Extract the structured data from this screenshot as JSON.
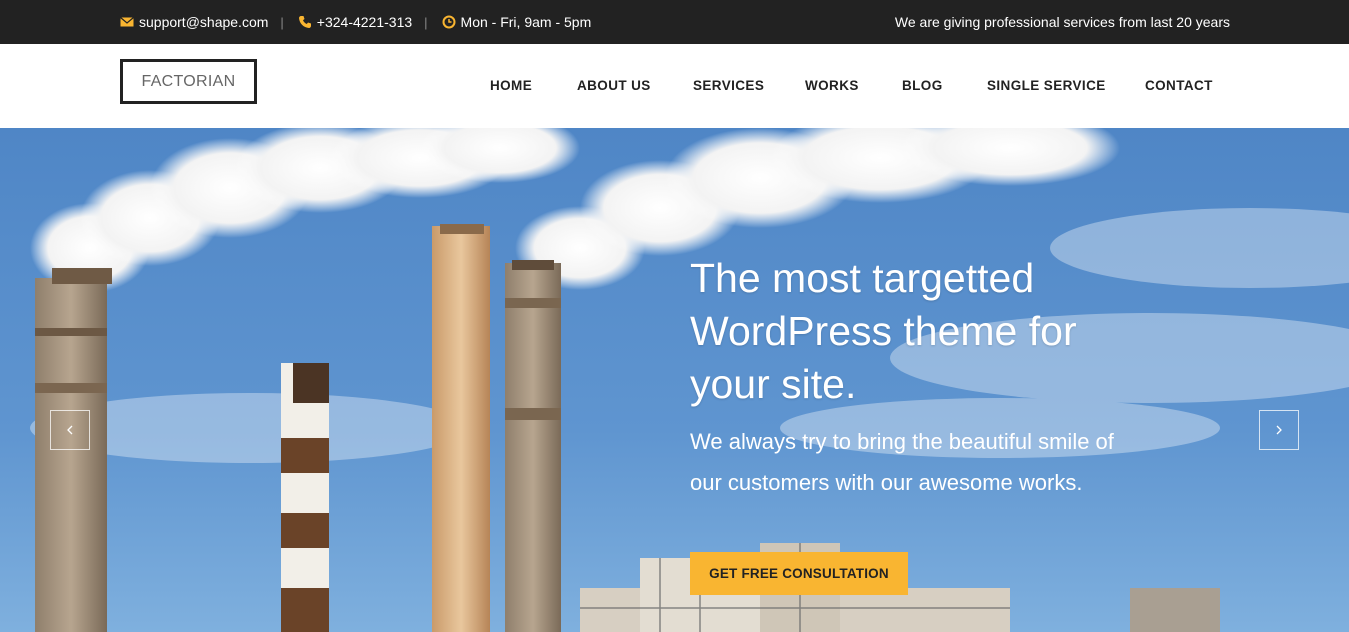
{
  "topbar": {
    "email": "support@shape.com",
    "phone": "+324-4221-313",
    "hours": "Mon - Fri, 9am - 5pm",
    "separator": "|",
    "tagline": "We are giving professional services from last 20 years",
    "icons": [
      "envelope-icon",
      "phone-icon",
      "clock-icon"
    ],
    "icon_color": "#f9b531"
  },
  "header": {
    "logo": "FACTORIAN",
    "nav": [
      "HOME",
      "ABOUT US",
      "SERVICES",
      "WORKS",
      "BLOG",
      "SINGLE SERVICE",
      "CONTACT"
    ]
  },
  "hero": {
    "title": "The most targetted WordPress theme for your site.",
    "subtitle": "We always try to bring the beautiful smile of our customers with our awesome works.",
    "cta": "GET FREE CONSULTATION",
    "prev_icon": "chevron-left-icon",
    "next_icon": "chevron-right-icon",
    "cta_color": "#f9b531"
  },
  "colors": {
    "topbar_bg": "#222222",
    "accent": "#f9b531"
  }
}
